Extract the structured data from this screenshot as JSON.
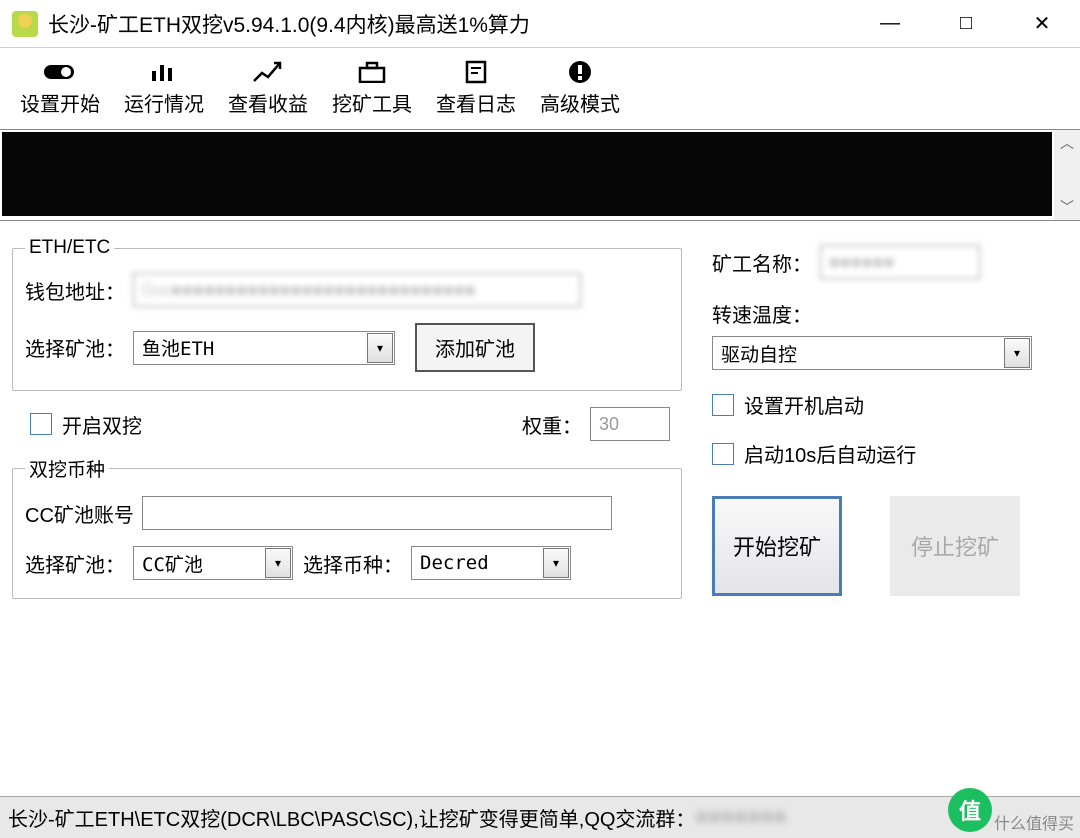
{
  "window": {
    "title": "长沙-矿工ETH双挖v5.94.1.0(9.4内核)最高送1%算力",
    "min": "—",
    "max": "□",
    "close": "✕"
  },
  "toolbar": [
    {
      "label": "设置开始",
      "icon": "toggle"
    },
    {
      "label": "运行情况",
      "icon": "chart"
    },
    {
      "label": "查看收益",
      "icon": "trend"
    },
    {
      "label": "挖矿工具",
      "icon": "briefcase"
    },
    {
      "label": "查看日志",
      "icon": "doc"
    },
    {
      "label": "高级模式",
      "icon": "alert"
    }
  ],
  "eth": {
    "legend": "ETH/ETC",
    "wallet_label": "钱包地址：",
    "wallet_value": "0xe■■■■■■■■■■■■■■■■■■■■■■■■■■■■",
    "pool_label": "选择矿池：",
    "pool_value": "鱼池ETH",
    "add_pool_btn": "添加矿池"
  },
  "dual": {
    "enable_label": "开启双挖",
    "weight_label": "权重：",
    "weight_value": "30",
    "legend": "双挖币种",
    "cc_label": "CC矿池账号",
    "cc_value": "",
    "pool_label": "选择矿池：",
    "pool_value": "CC矿池",
    "coin_label": "选择币种：",
    "coin_value": "Decred"
  },
  "right": {
    "worker_label": "矿工名称：",
    "worker_value": "■■■■■■",
    "fan_label": "转速温度：",
    "fan_value": "驱动自控",
    "autostart_label": "设置开机启动",
    "autorun_label": "启动10s后自动运行",
    "start_btn": "开始挖矿",
    "stop_btn": "停止挖矿"
  },
  "footer": {
    "text": "长沙-矿工ETH\\ETC双挖(DCR\\LBC\\PASC\\SC),让挖矿变得更简单,QQ交流群：",
    "blurred": "■■■■■■■",
    "logo": "值",
    "sub": "什么值得买"
  }
}
